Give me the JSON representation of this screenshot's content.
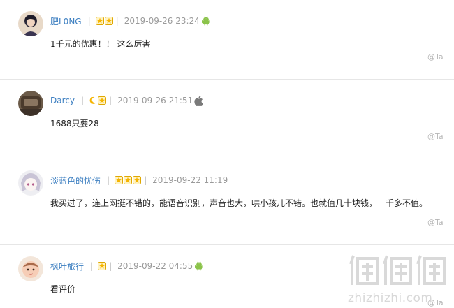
{
  "comments": [
    {
      "username": "肥L0NG",
      "rank_icons": [
        "star-icon",
        "star-icon"
      ],
      "separator": "|",
      "timestamp": "2019-09-26 23:24",
      "device_icon": "android-icon",
      "text": "1千元的优惠！！ 这么厉害",
      "reply": "@Ta"
    },
    {
      "username": "Darcy",
      "rank_icons": [
        "moon-icon",
        "star-icon"
      ],
      "separator": "|",
      "timestamp": "2019-09-26 21:51",
      "device_icon": "apple-icon",
      "text": "1688只要28",
      "reply": "@Ta"
    },
    {
      "username": "淡蓝色的忧伤",
      "rank_icons": [
        "star-icon",
        "star-icon",
        "star-icon"
      ],
      "separator": "|",
      "timestamp": "2019-09-22 11:19",
      "device_icon": "",
      "text": "我买过了，连上网挺不错的，能语音识别，声音也大，哄小孩儿不错。也就值几十块钱，一千多不值。",
      "reply": "@Ta"
    },
    {
      "username": "枫叶旅行",
      "rank_icons": [
        "star-icon"
      ],
      "separator": "|",
      "timestamp": "2019-09-22 04:55",
      "device_icon": "android-icon",
      "text": "看评价",
      "reply": "@Ta"
    }
  ],
  "watermark": {
    "url": "zhizhizhi.com"
  },
  "colors": {
    "username": "#3d7fc1",
    "timestamp": "#9a9a9a",
    "star": "#f5b400",
    "android": "#8bc34a",
    "divider": "#e6e6e6"
  }
}
